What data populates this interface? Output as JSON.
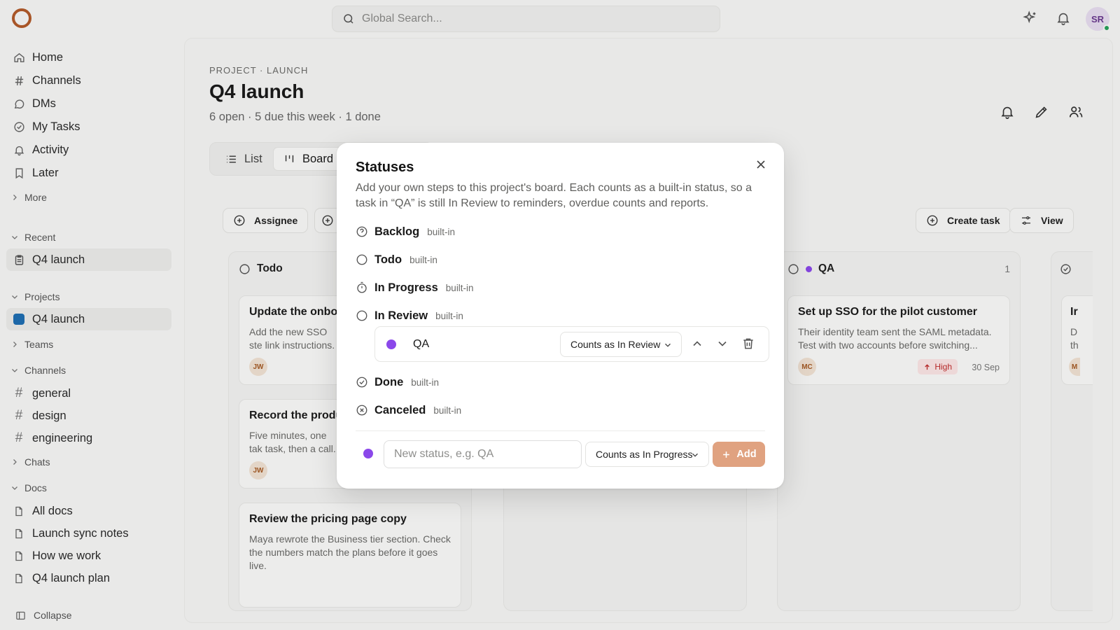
{
  "topbar": {
    "search_placeholder": "Global Search...",
    "user_initials": "SR"
  },
  "sidebar": {
    "nav": [
      {
        "label": "Home",
        "icon": "home-icon"
      },
      {
        "label": "Channels",
        "icon": "hash-icon"
      },
      {
        "label": "DMs",
        "icon": "message-icon"
      },
      {
        "label": "My Tasks",
        "icon": "check-circle-icon"
      },
      {
        "label": "Activity",
        "icon": "bell-icon"
      },
      {
        "label": "Later",
        "icon": "bookmark-icon"
      }
    ],
    "more_label": "More",
    "recent_label": "Recent",
    "recent_item": "Q4 launch",
    "projects_label": "Projects",
    "project_item": "Q4 launch",
    "teams_label": "Teams",
    "channels_label": "Channels",
    "channels": [
      "general",
      "design",
      "engineering"
    ],
    "chats_label": "Chats",
    "docs_label": "Docs",
    "docs": [
      "All docs",
      "Launch sync notes",
      "How we work",
      "Q4 launch plan"
    ],
    "collapse_label": "Collapse"
  },
  "page": {
    "breadcrumb": "PROJECT · LAUNCH",
    "title": "Q4 launch",
    "subtitle": "6 open · 5 due this week · 1 done",
    "tabs": [
      "List",
      "Board"
    ],
    "filters": {
      "assignee": "Assignee"
    },
    "actions": {
      "create_task": "Create task",
      "view": "View"
    },
    "columns": {
      "todo": {
        "name": "Todo",
        "cards": [
          {
            "title": "Update the onboa",
            "desc": "Add the new SSO ste link instructions.",
            "assignee": "JW"
          },
          {
            "title": "Record the produ",
            "desc": "Five minutes, one tak task, then a call.",
            "assignee": "JW"
          },
          {
            "title": "Review the pricing page copy",
            "desc": "Maya rewrote the Business tier section. Check the numbers match the plans before it goes live."
          }
        ]
      },
      "qa": {
        "name": "QA",
        "count": "1",
        "cards": [
          {
            "title": "Set up SSO for the pilot customer",
            "desc": "Their identity team sent the SAML metadata. Test with two accounts before switching...",
            "assignee": "MC",
            "priority": "High",
            "due": "30 Sep"
          }
        ]
      },
      "done_partial": {
        "card_title": "Ir",
        "card_desc": "D th",
        "assignee": "M"
      }
    }
  },
  "dialog": {
    "title": "Statuses",
    "description": "Add your own steps to this project's board. Each counts as a built-in status, so a task in “QA” is still In Review to reminders, overdue counts and reports.",
    "builtin_badge": "built-in",
    "statuses": [
      {
        "name": "Backlog",
        "icon": "help-circle-icon"
      },
      {
        "name": "Todo",
        "icon": "circle-icon"
      },
      {
        "name": "In Progress",
        "icon": "timer-icon"
      },
      {
        "name": "In Review",
        "icon": "dots-circle-icon"
      },
      {
        "name": "Done",
        "icon": "check-circle-icon"
      },
      {
        "name": "Canceled",
        "icon": "x-circle-icon"
      }
    ],
    "custom_status": {
      "name": "QA",
      "counts_as": "Counts as In Review",
      "color": "#8b48ea"
    },
    "new_status": {
      "placeholder": "New status, e.g. QA",
      "counts_as": "Counts as In Progress",
      "color": "#8b48ea"
    },
    "add_label": "Add"
  },
  "colors": {
    "accent": "#e0a280",
    "project": "#1f6fb2",
    "status_dot": "#8b48ea",
    "priority_high": "#c02d2d"
  }
}
